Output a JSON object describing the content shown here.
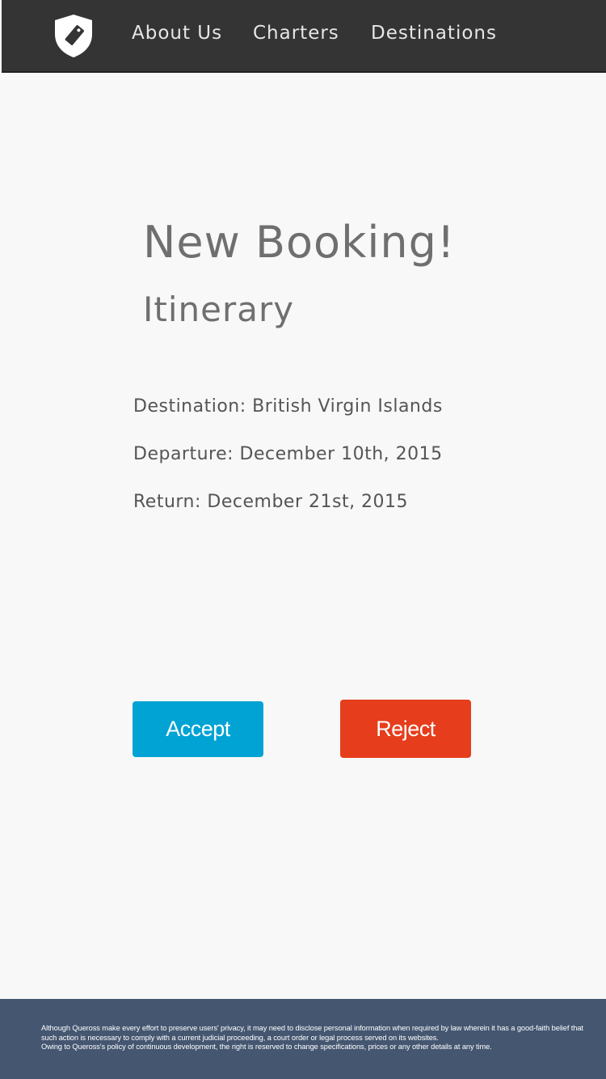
{
  "nav": {
    "logo_icon": "shield-tag-icon",
    "links": [
      "About Us",
      "Charters",
      "Destinations"
    ]
  },
  "main": {
    "heading": "New Booking!",
    "subheading": "Itinerary",
    "destination": "Destination: British Virgin Islands",
    "departure": "Departure: December 10th, 2015",
    "return": "Return: December 21st, 2015"
  },
  "actions": {
    "accept_label": "Accept",
    "reject_label": "Reject",
    "accept_color": "#00a3d4",
    "reject_color": "#e63d1c"
  },
  "footer": {
    "line1": "Although Queross make every effort to preserve users' privacy, it may need to disclose personal information when required by law wherein it has a good-faith belief that such action is necessary to comply with a current judicial proceeding, a court order or legal process served on its websites.",
    "line2": "Owing to Queross's policy of continuous development, the right is reserved to change specifications, prices or any other details at any time."
  },
  "colors": {
    "navbar": "#343434",
    "footer": "#445670",
    "background": "#f8f8f8",
    "heading_text": "#6f6f6f"
  }
}
